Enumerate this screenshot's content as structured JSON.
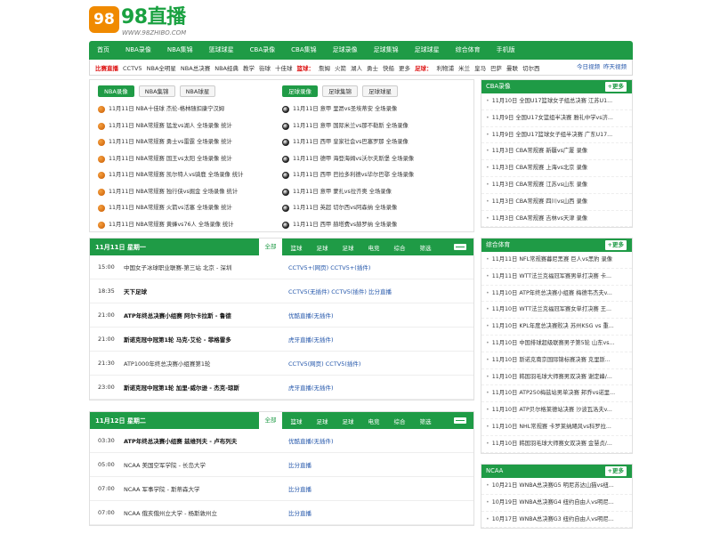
{
  "logo": {
    "mark": "98",
    "name": "98直播",
    "url": "WWW.98ZHIBO.COM"
  },
  "nav": [
    "首页",
    "NBA录像",
    "NBA集锦",
    "篮球球星",
    "CBA录像",
    "CBA集锦",
    "足球录像",
    "足球集锦",
    "足球球星",
    "综合体育",
    "手机版"
  ],
  "subnav": {
    "label": "比赛直播",
    "items": [
      "CCTV5",
      "NBA全明星",
      "NBA总决赛",
      "NBA经典",
      "教学",
      "街球",
      "十佳球"
    ],
    "basket_label": "篮球：",
    "basket_items": [
      "詹姆",
      "火箭",
      "湖人",
      "勇士",
      "快船",
      "更多"
    ],
    "foot_label": "足球：",
    "foot_items": [
      "利物浦",
      "米兰",
      "皇马",
      "巴萨",
      "曼联",
      "切尔西"
    ],
    "right": [
      "今日视频",
      "昨天视频"
    ]
  },
  "left_box": {
    "tabs": [
      "NBA录像",
      "NBA集锦",
      "NBA球星"
    ],
    "items": [
      "11月11日 NBA十佳球 杰伦-格林随扣康宁汉姆",
      "11月11日 NBA常规赛 猛龙vs湖人 全场录像 统计",
      "11月11日 NBA常规赛 勇士vs雷霆 全场录像 统计",
      "11月11日 NBA常规赛 国王vs太阳 全场录像 统计",
      "11月11日 NBA常规赛 凯尔特人vs骑鹿 全场录像 统计",
      "11月11日 NBA常规赛 独行侠vs掘金 全场录像 统计",
      "11月11日 NBA常规赛 火箭vs活塞 全场录像 统计",
      "11月11日 NBA常规赛 黄蜂vs76人 全场录像 统计"
    ]
  },
  "right_box": {
    "tabs": [
      "足球录像",
      "足球集锦",
      "足球球星"
    ],
    "items": [
      "11月11日 意甲 里昂vs圣埃蒂安 全场录像",
      "11月11日 意甲 国际米兰vs那不勒斯 全场录像",
      "11月11日 西甲 皇家社会vs巴塞罗那 全场录像",
      "11月11日 德甲 海登海姆vs沃尔夫斯堡 全场录像",
      "11月11日 西甲 巴拉多利德vs毕尔巴鄂 全场录像",
      "11月11日 意甲 蒙扎vs拉齐奥 全场录像",
      "11月11日 英超 切尔西vs阿森纳 全场录像",
      "11月11日 西甲 赫塔费vs赫罗纳 全场录像"
    ]
  },
  "schedule_tabs": [
    "全部",
    "篮球",
    "足球",
    "足球",
    "电竞",
    "综合",
    "筛选"
  ],
  "day1": {
    "date": "11月11日 星期一",
    "rows": [
      {
        "time": "15:00",
        "name": "中国女子冰球职业联赛-第三站  北京 - 深圳",
        "bold": false,
        "ch": "CCTV5+(网页) CCTV5+(插件)"
      },
      {
        "time": "18:35",
        "name": "天下足球",
        "bold": true,
        "ch": "CCTV5(无插件) CCTV5(插件) 比分直播"
      },
      {
        "time": "21:00",
        "name": "ATP年终总决赛小组赛   阿尔卡拉斯 - 鲁德",
        "bold": true,
        "ch": "优酷直播(无插件)"
      },
      {
        "time": "21:00",
        "name": "斯诺克冠中冠第1轮   马克-艾伦 - 菲格雷多",
        "bold": true,
        "ch": "虎牙直播(无插件)"
      },
      {
        "time": "21:30",
        "name": "ATP1000年终总决赛小组赛第1轮",
        "bold": false,
        "ch": "CCTV5(网页) CCTV5(插件)"
      },
      {
        "time": "23:00",
        "name": "斯诺克冠中冠第1轮   加里-威尔逊 - 杰克-琼斯",
        "bold": true,
        "ch": "虎牙直播(无插件)"
      }
    ]
  },
  "day2": {
    "date": "11月12日 星期二",
    "rows": [
      {
        "time": "03:30",
        "name": "ATP年终总决赛小组赛   兹维列夫 - 卢布列夫",
        "bold": true,
        "ch": "优酷直播(无插件)"
      },
      {
        "time": "05:00",
        "name": "NCAA   美国空军学院 - 长岛大学",
        "bold": false,
        "ch": "比分直播"
      },
      {
        "time": "07:00",
        "name": "NCAA   军事学院 - 斯蒂森大学",
        "bold": false,
        "ch": "比分直播"
      },
      {
        "time": "07:00",
        "name": "NCAA   俄亥俄州立大学 - 杨斯敦州立",
        "bold": false,
        "ch": "比分直播"
      }
    ]
  },
  "side": [
    {
      "title": "CBA录像",
      "more": "+更多",
      "items": [
        "11月10日 全国U17篮球女子组总决赛 江苏U1...",
        "11月9日 全国U17女篮组半决赛 雅礼中学vs济...",
        "11月9日 全国U17篮球女子组半决赛 广东U17...",
        "11月3日 CBA常规赛 新疆vs广厦 录像",
        "11月3日 CBA常规赛 上海vs北京 录像",
        "11月3日 CBA常规赛 江苏vs山东 录像",
        "11月3日 CBA常规赛 四川vs山西 录像",
        "11月3日 CBA常规赛 吉林vs天津 录像"
      ]
    },
    {
      "title": "综合体育",
      "more": "+更多",
      "items": [
        "11月11日 NFL常规赛暮尼黑赛 巨人vs黑豹 录像",
        "11月11日 WTT法兰克福冠军赛男单打决赛 卡...",
        "11月10日 ATP年终总决赛小组赛 梅德韦杰夫v...",
        "11月10日 WTT法兰克福冠军赛女单打决赛 王...",
        "11月10日 KPL年度总决赛败决 苏州KSG vs 重...",
        "11月10日 中国排球超级联赛男子第5轮 山东vs...",
        "11月10日 斯诺克南京国际锦标赛决赛 克里斯...",
        "11月10日 韩国羽毛球大师赛男双决赛 谢定峰/...",
        "11月10日 ATP250梅兹站男单决赛 邦乔vs诺里...",
        "11月10日 ATP贝尔格莱德站决赛 沙波瓦洛夫v...",
        "11月10日 NHL常规赛 卡罗莱纳飓风vs科罗拉...",
        "11月10日 韩国羽毛球大师赛女双决赛 金慧贞/..."
      ]
    },
    {
      "title": "NCAA",
      "more": "+更多",
      "items": [
        "10月21日 WNBA总决赛G5 明尼苏达山猫vs纽...",
        "10月19日 WNBA总决赛G4 纽约自由人vs明尼...",
        "10月17日 WNBA总决赛G3 纽约自由人vs明尼..."
      ]
    }
  ]
}
